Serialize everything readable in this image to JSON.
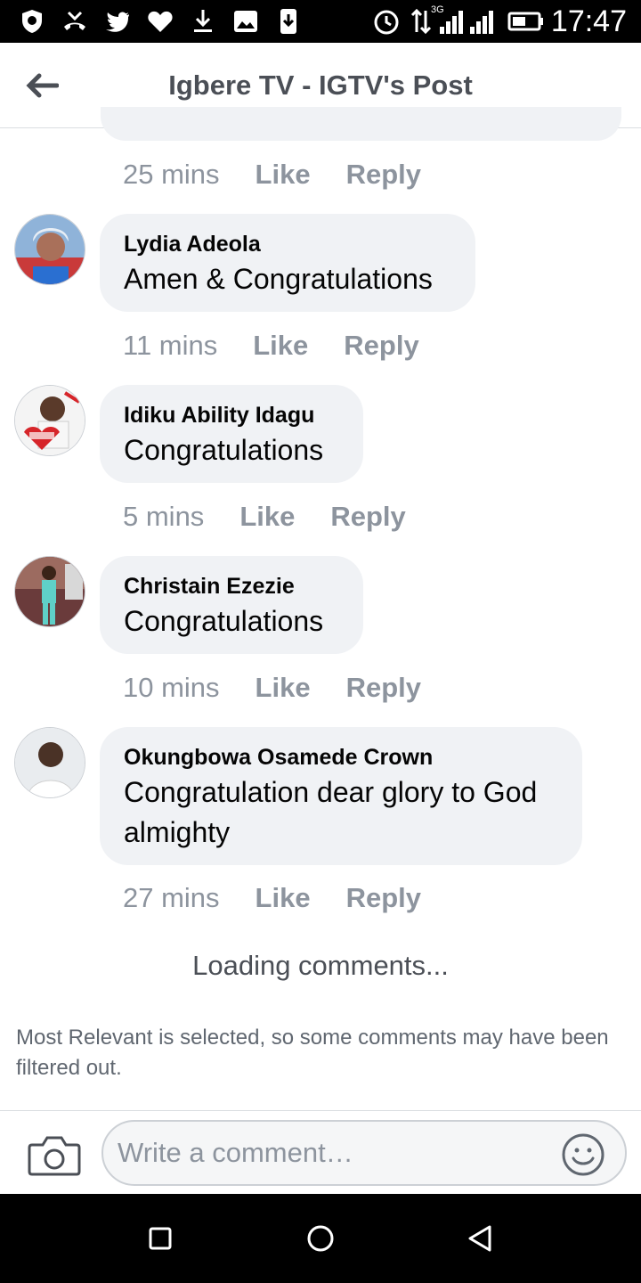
{
  "status_bar": {
    "time": "17:47",
    "network": "3G",
    "icons": [
      "shield-icon",
      "missed-call-icon",
      "twitter-icon",
      "heart-icon",
      "download-icon",
      "image-icon",
      "download-box-icon",
      "alarm-icon",
      "data-arrows-icon",
      "signal-icon",
      "signal-icon",
      "battery-icon"
    ]
  },
  "header": {
    "title": "Igbere TV - IGTV's Post",
    "back_icon": "back-arrow-icon"
  },
  "labels": {
    "like": "Like",
    "reply": "Reply"
  },
  "prior_comment": {
    "time": "25 mins"
  },
  "comments": [
    {
      "author": "Lydia Adeola",
      "text": "Amen & Congratulations",
      "time": "11 mins"
    },
    {
      "author": "Idiku Ability Idagu",
      "text": "Congratulations",
      "time": "5 mins"
    },
    {
      "author": "Christain Ezezie",
      "text": "Congratulations",
      "time": "10 mins"
    },
    {
      "author": "Okungbowa Osamede Crown",
      "text": "Congratulation dear glory to God almighty",
      "time": "27 mins"
    }
  ],
  "loading_text": "Loading comments...",
  "filter_notice": "Most Relevant is selected, so some comments may have been filtered out.",
  "composer": {
    "placeholder": "Write a comment…",
    "camera_icon": "camera-icon",
    "emoji_icon": "emoji-icon"
  },
  "nav_bar": {
    "icons": [
      "recents-square-icon",
      "home-circle-icon",
      "back-triangle-icon"
    ]
  },
  "colors": {
    "bubble": "#f0f2f5",
    "meta_text": "#8d949e",
    "title_text": "#4b4f56"
  }
}
